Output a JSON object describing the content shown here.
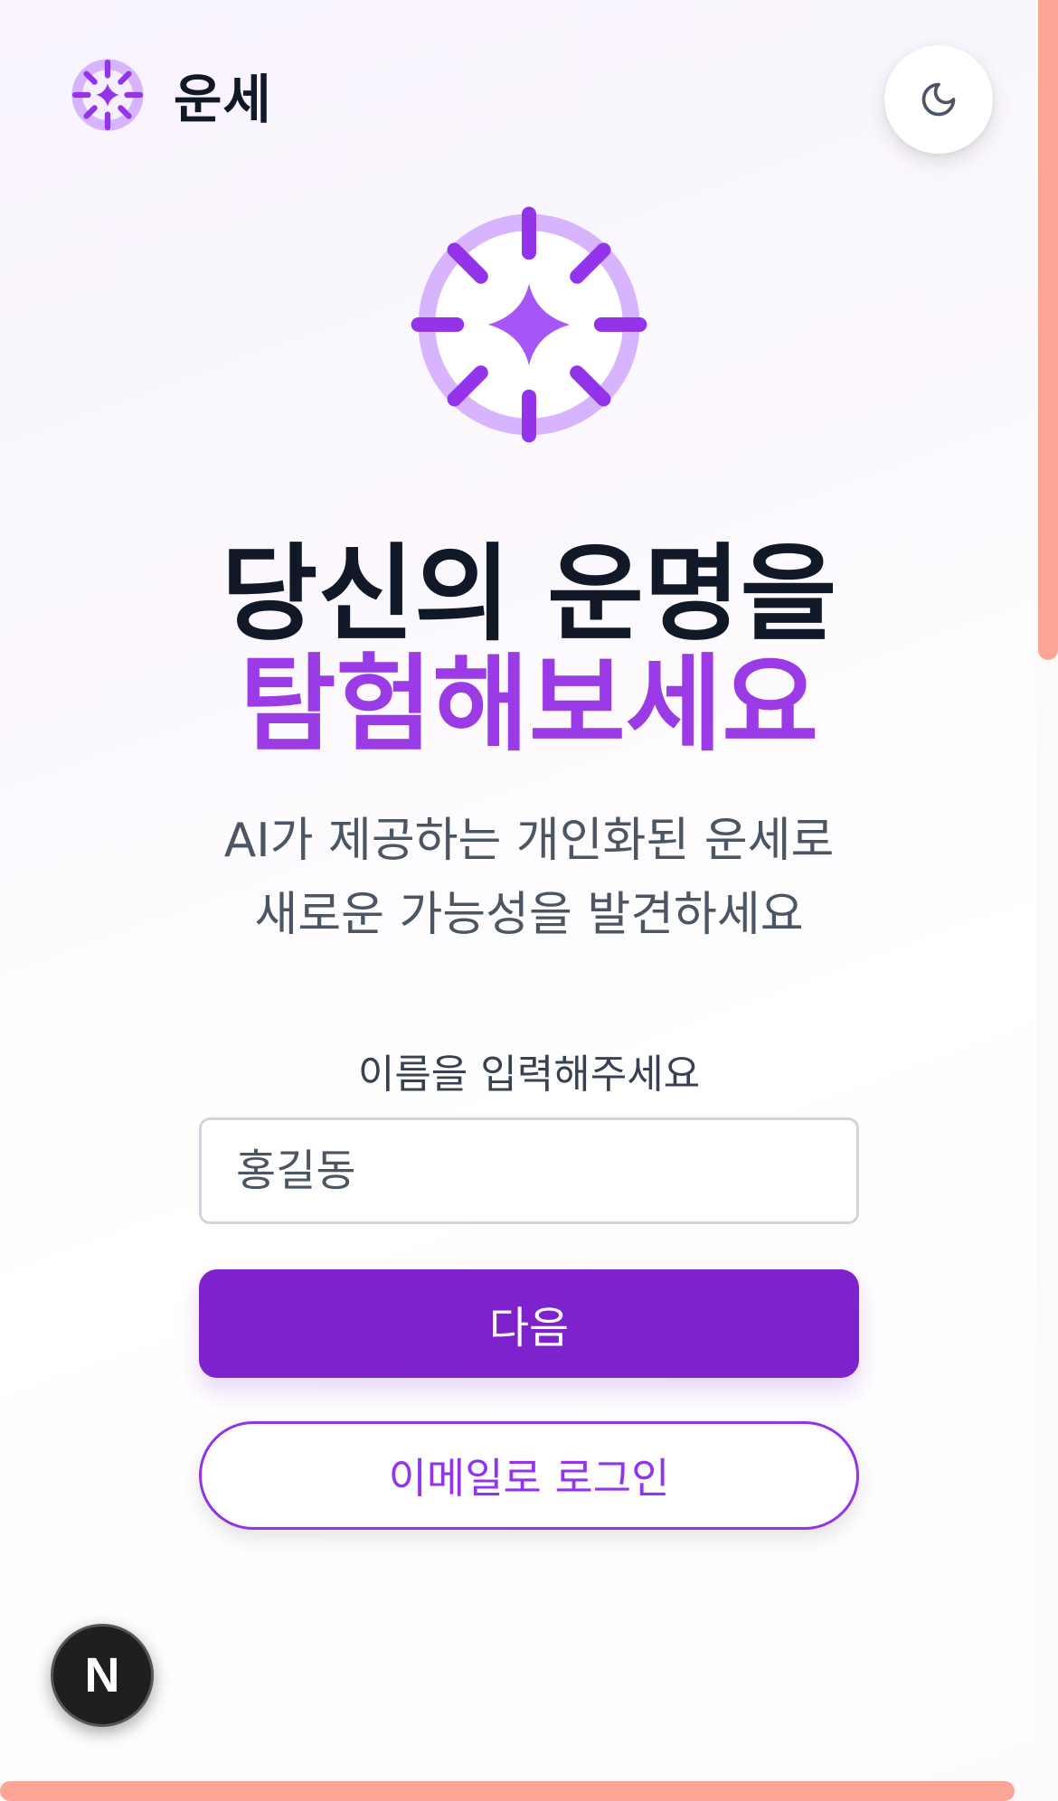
{
  "app": {
    "name": "운세",
    "logo_icon": "sparkle-compass-icon",
    "theme_toggle_icon": "moon-icon"
  },
  "hero": {
    "icon": "sparkle-compass-icon",
    "title_line1": "당신의 운명을",
    "title_line2": "탐험해보세요",
    "subtitle_line1": "AI가 제공하는 개인화된 운세로",
    "subtitle_line2": "새로운 가능성을 발견하세요"
  },
  "form": {
    "name_label": "이름을 입력해주세요",
    "name_placeholder": "홍길동",
    "name_value": "",
    "next_label": "다음",
    "email_login_label": "이메일로 로그인"
  },
  "badge": {
    "label": "N"
  },
  "colors": {
    "primary": "#7e22ce",
    "accent": "#9b3be6",
    "accent_light": "#d8b4fe",
    "title": "#111827",
    "subtitle": "#4b5563",
    "scroll_thumb": "#fca596"
  }
}
